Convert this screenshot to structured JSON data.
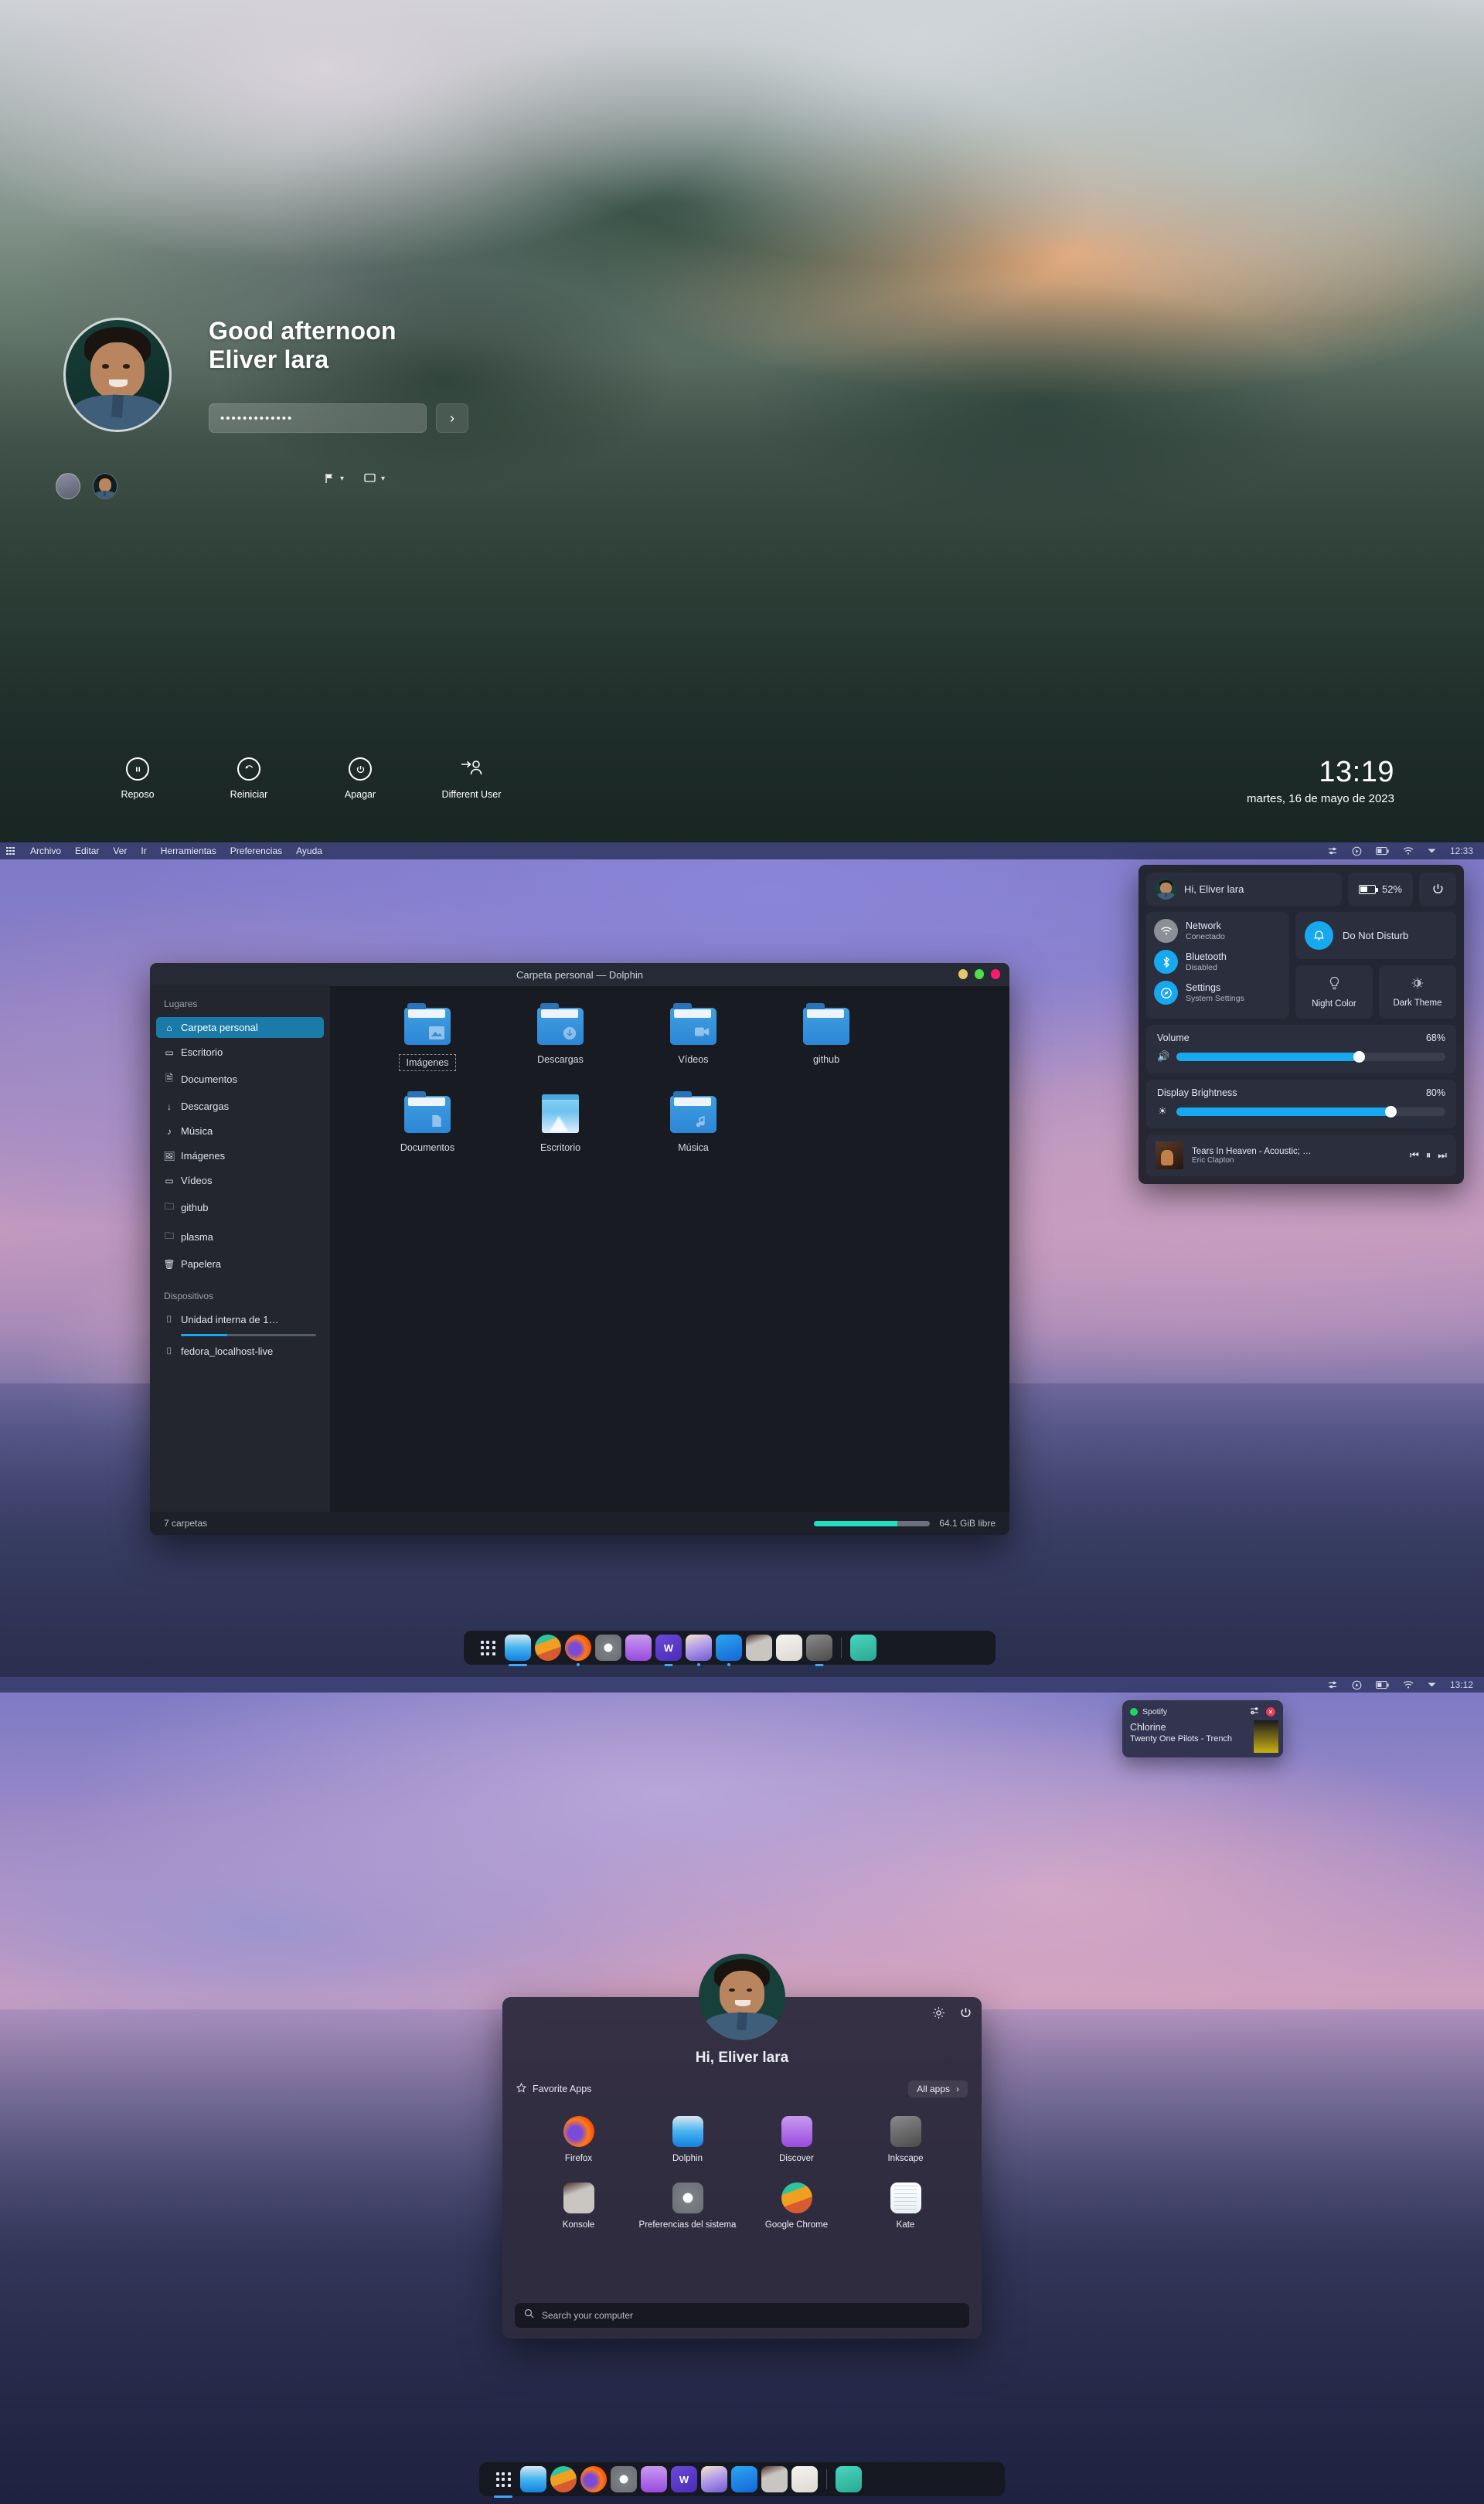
{
  "lockscreen": {
    "greeting": "Good afternoon",
    "username": "Eliver lara",
    "password_masked": "•••••••••••••",
    "login_arrow": "›",
    "keyboard_layout_icon": "flag-icon",
    "session_icon": "monitor-icon",
    "actions": [
      {
        "label": "Reposo",
        "icon": "suspend-icon"
      },
      {
        "label": "Reiniciar",
        "icon": "restart-icon"
      },
      {
        "label": "Apagar",
        "icon": "power-icon"
      },
      {
        "label": "Different User",
        "icon": "switch-user-icon"
      }
    ],
    "clock_time": "13:19",
    "clock_date": "martes, 16 de mayo de 2023"
  },
  "desktop1": {
    "menubar": {
      "app_grid_icon": "app-grid-icon",
      "items": [
        "Archivo",
        "Editar",
        "Ver",
        "Ir",
        "Herramientas",
        "Preferencias",
        "Ayuda"
      ],
      "tray_icons": [
        "audio-mixer-icon",
        "media-player-icon",
        "battery-icon",
        "wifi-icon",
        "chevron-down-icon"
      ],
      "clock": "12:33"
    },
    "dolphin": {
      "title": "Carpeta personal — Dolphin",
      "window_buttons": [
        "minimize",
        "maximize",
        "close"
      ],
      "places_header": "Lugares",
      "places": [
        {
          "label": "Carpeta personal",
          "icon": "home-icon",
          "active": true
        },
        {
          "label": "Escritorio",
          "icon": "desktop-icon",
          "active": false
        },
        {
          "label": "Documentos",
          "icon": "documents-icon",
          "active": false
        },
        {
          "label": "Descargas",
          "icon": "download-icon",
          "active": false
        },
        {
          "label": "Música",
          "icon": "music-icon",
          "active": false
        },
        {
          "label": "Imágenes",
          "icon": "image-icon",
          "active": false
        },
        {
          "label": "Vídeos",
          "icon": "video-icon",
          "active": false
        },
        {
          "label": "github",
          "icon": "folder-icon",
          "active": false
        },
        {
          "label": "plasma",
          "icon": "folder-icon",
          "active": false
        },
        {
          "label": "Papelera",
          "icon": "trash-icon",
          "active": false
        }
      ],
      "devices_header": "Dispositivos",
      "devices": [
        {
          "label": "Unidad interna de 1…",
          "icon": "drive-icon",
          "usage_percent": 34
        },
        {
          "label": "fedora_localhost-live",
          "icon": "drive-icon",
          "usage_percent": 0
        }
      ],
      "files": [
        {
          "name": "Imágenes",
          "type": "folder-image",
          "selected": true
        },
        {
          "name": "Descargas",
          "type": "folder-download",
          "selected": false
        },
        {
          "name": "Vídeos",
          "type": "folder-video",
          "selected": false
        },
        {
          "name": "github",
          "type": "folder-plain",
          "selected": false
        },
        {
          "name": "Documentos",
          "type": "folder-document",
          "selected": false
        },
        {
          "name": "Escritorio",
          "type": "folder-thumbnail",
          "selected": false
        },
        {
          "name": "Música",
          "type": "folder-music",
          "selected": false
        }
      ],
      "status_count": "7 carpetas",
      "status_free": "64.1 GiB libre",
      "status_used_percent": 72
    },
    "tray_popup": {
      "user_greeting": "Hi, Eliver lara",
      "battery_percent": "52%",
      "power_icon": "power-icon",
      "toggles": [
        {
          "label": "Network",
          "status": "Conectado",
          "icon": "wifi-icon",
          "state": "off"
        },
        {
          "label": "Bluetooth",
          "status": "Disabled",
          "icon": "bluetooth-icon",
          "state": "on"
        },
        {
          "label": "Settings",
          "status": "System Settings",
          "icon": "gear-icon",
          "state": "on"
        }
      ],
      "dnd": {
        "label": "Do Not Disturb",
        "icon": "bell-icon"
      },
      "squares": [
        {
          "label": "Night Color",
          "icon": "bulb-icon"
        },
        {
          "label": "Dark Theme",
          "icon": "contrast-icon"
        }
      ],
      "volume": {
        "label": "Volume",
        "value": "68%",
        "percent": 68,
        "icon": "speaker-icon"
      },
      "brightness": {
        "label": "Display Brightness",
        "value": "80%",
        "percent": 80,
        "icon": "brightness-icon"
      },
      "media": {
        "title": "Tears In Heaven - Acoustic; …",
        "artist": "Eric Clapton",
        "controls": [
          "previous-icon",
          "pause-icon",
          "next-icon"
        ]
      }
    },
    "dock": {
      "launcher_icon": "app-grid-icon",
      "apps": [
        {
          "name": "Dolphin",
          "icon": "dolphin-icon",
          "indicator": "active"
        },
        {
          "name": "Google Chrome",
          "icon": "chrome-icon",
          "indicator": "none"
        },
        {
          "name": "Firefox",
          "icon": "firefox-icon",
          "indicator": "single"
        },
        {
          "name": "Preferencias del sistema",
          "icon": "settings-icon",
          "indicator": "none"
        },
        {
          "name": "Discover",
          "icon": "discover-icon",
          "indicator": "none"
        },
        {
          "name": "Office",
          "icon": "word-icon",
          "indicator": "double"
        },
        {
          "name": "Gallery",
          "icon": "gallery-icon",
          "indicator": "single"
        },
        {
          "name": "VS Code",
          "icon": "vscode-icon",
          "indicator": "single"
        },
        {
          "name": "Konsole",
          "icon": "konsole-icon",
          "indicator": "none"
        },
        {
          "name": "Kvantum",
          "icon": "kvantum-icon",
          "indicator": "none"
        },
        {
          "name": "Inkscape",
          "icon": "inkscape-icon",
          "indicator": "double"
        },
        {
          "name": "Papelera",
          "icon": "trash-icon",
          "indicator": "none"
        }
      ]
    }
  },
  "desktop2": {
    "menubar": {
      "app_grid_icon": "app-grid-icon",
      "tray_icons": [
        "audio-mixer-icon",
        "media-player-icon",
        "battery-icon",
        "wifi-icon",
        "chevron-down-icon"
      ],
      "clock": "13:12"
    },
    "notification": {
      "app": "Spotify",
      "title": "Chlorine",
      "subtitle": "Twenty One Pilots - Trench",
      "settings_icon": "sliders-icon",
      "close_icon": "close-icon"
    },
    "launcher": {
      "greeting": "Hi, Eliver lara",
      "settings_icon": "gear-icon",
      "power_icon": "power-icon",
      "favorites_label": "Favorite Apps",
      "favorites_icon": "star-icon",
      "all_apps_label": "All apps",
      "all_apps_icon": "chevron-right-icon",
      "apps": [
        {
          "name": "Firefox",
          "icon": "firefox-icon"
        },
        {
          "name": "Dolphin",
          "icon": "dolphin-icon"
        },
        {
          "name": "Discover",
          "icon": "discover-icon"
        },
        {
          "name": "Inkscape",
          "icon": "inkscape-icon"
        },
        {
          "name": "Konsole",
          "icon": "konsole-icon"
        },
        {
          "name": "Preferencias del sistema",
          "icon": "settings-icon"
        },
        {
          "name": "Google Chrome",
          "icon": "chrome-icon"
        },
        {
          "name": "Kate",
          "icon": "kate-icon"
        }
      ],
      "search_placeholder": "Search your computer",
      "search_icon": "search-icon"
    },
    "dock": {
      "launcher_icon": "app-grid-icon",
      "apps": [
        {
          "name": "Dolphin",
          "icon": "dolphin-icon",
          "indicator": "active"
        },
        {
          "name": "Google Chrome",
          "icon": "chrome-icon",
          "indicator": "none"
        },
        {
          "name": "Firefox",
          "icon": "firefox-icon",
          "indicator": "none"
        },
        {
          "name": "Preferencias del sistema",
          "icon": "settings-icon",
          "indicator": "none"
        },
        {
          "name": "Discover",
          "icon": "discover-icon",
          "indicator": "none"
        },
        {
          "name": "Office",
          "icon": "word-icon",
          "indicator": "none"
        },
        {
          "name": "Gallery",
          "icon": "gallery-icon",
          "indicator": "none"
        },
        {
          "name": "VS Code",
          "icon": "vscode-icon",
          "indicator": "none"
        },
        {
          "name": "Konsole",
          "icon": "konsole-icon",
          "indicator": "none"
        },
        {
          "name": "Kvantum",
          "icon": "kvantum-icon",
          "indicator": "none"
        },
        {
          "name": "Papelera",
          "icon": "trash-icon",
          "indicator": "none"
        }
      ]
    }
  },
  "colors": {
    "accent": "#17a9f0",
    "panel": "#3b4173",
    "dark_surface": "#2b2e3d",
    "teal": "#1fe0c0",
    "spotify_green": "#1ed760"
  }
}
